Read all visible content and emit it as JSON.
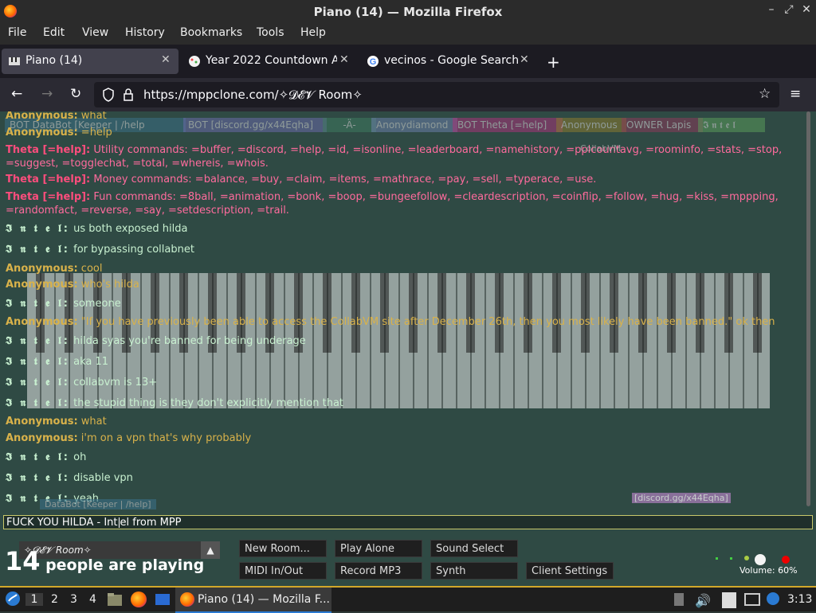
{
  "window": {
    "title": "Piano (14) — Mozilla Firefox",
    "controls": [
      "–",
      "⤢",
      "✕"
    ]
  },
  "menu": [
    "File",
    "Edit",
    "View",
    "History",
    "Bookmarks",
    "Tools",
    "Help"
  ],
  "tabs": [
    {
      "label": "Piano (14)",
      "active": true
    },
    {
      "label": "Year 2022 Countdown Ar",
      "active": false
    },
    {
      "label": "vecinos - Google Search",
      "active": false
    }
  ],
  "nav": {
    "url": "https://mppclone.com/✧𝓓𝓔𝓥 Room✧"
  },
  "usertags": [
    {
      "label": "BOT  DataBot [Keeper | /help",
      "color": "#3a6f87"
    },
    {
      "label": "BOT  [discord.gg/x44Eqha]",
      "color": "#6a6aa8"
    },
    {
      "label": "-Ä-",
      "color": "#3f7a60"
    },
    {
      "label": "Anonydiamond",
      "color": "#6a7ea8"
    },
    {
      "label": "BOT  Theta [=help]",
      "color": "#a8347a"
    },
    {
      "label": "Anonymous",
      "color": "#8a7a30"
    },
    {
      "label": "OWNER  Lapis",
      "color": "#8a3a5a"
    },
    {
      "label": "𝕴 𝖓 𝖙 𝖊 𝖑",
      "color": "#5a9a5a"
    }
  ],
  "chat": [
    {
      "type": "anon",
      "name": "Anonymous:",
      "text": "what"
    },
    {
      "type": "anon",
      "name": "Anonymous:",
      "text": "=help"
    },
    {
      "type": "theta",
      "name": "Theta [=help]:",
      "text": "Utility commands: =buffer, =discord, =help, =id, =isonline, =leaderboard, =namehistory, =pplcountavg, =roominfo, =stats, =stop, =suggest, =togglechat, =total, =whereis, =whois."
    },
    {
      "type": "theta",
      "name": "Theta [=help]:",
      "text": "Money commands: =balance, =buy, =claim, =items, =mathrace, =pay, =sell, =typerace, =use."
    },
    {
      "type": "theta",
      "name": "Theta [=help]:",
      "text": "Fun commands: =8ball, =animation, =bonk, =boop, =bungeefollow, =cleardescription, =coinflip, =follow, =hug, =kiss, =mppping, =randomfact, =reverse, =say, =setdescription, =trail."
    },
    {
      "type": "intel",
      "name": "𝕴 𝖓 𝖙 𝖊 𝖑:",
      "text": "us both exposed hilda"
    },
    {
      "type": "intel",
      "name": "𝕴 𝖓 𝖙 𝖊 𝖑:",
      "text": "for bypassing collabnet"
    },
    {
      "type": "anon",
      "name": "Anonymous:",
      "text": "cool"
    },
    {
      "type": "anon",
      "name": "Anonymous:",
      "text": "who's hilda"
    },
    {
      "type": "intel",
      "name": "𝕴 𝖓 𝖙 𝖊 𝖑:",
      "text": "someone"
    },
    {
      "type": "anon",
      "name": "Anonymous:",
      "text": "\"If you have previously been able to access the CollabVM site after December 26th, then you most likely have been banned.\" ok then"
    },
    {
      "type": "intel",
      "name": "𝕴 𝖓 𝖙 𝖊 𝖑:",
      "text": "hilda syas you're banned for being underage"
    },
    {
      "type": "intel",
      "name": "𝕴 𝖓 𝖙 𝖊 𝖑:",
      "text": "aka 11"
    },
    {
      "type": "intel",
      "name": "𝕴 𝖓 𝖙 𝖊 𝖑:",
      "text": "collabvm is 13+"
    },
    {
      "type": "intel",
      "name": "𝕴 𝖓 𝖙 𝖊 𝖑:",
      "text": "the stupid thing is they don't explicitly mention that"
    },
    {
      "type": "anon",
      "name": "Anonymous:",
      "text": "what"
    },
    {
      "type": "anon",
      "name": "Anonymous:",
      "text": "i'm on a vpn that's why probably"
    },
    {
      "type": "intel",
      "name": "𝕴 𝖓 𝖙 𝖊 𝖑:",
      "text": "oh"
    },
    {
      "type": "intel",
      "name": "𝕴 𝖓 𝖙 𝖊 𝖑:",
      "text": "disable vpn"
    },
    {
      "type": "intel",
      "name": "𝕴 𝖓 𝖙 𝖊 𝖑:",
      "text": "yeah"
    }
  ],
  "chat_input": {
    "value_before_cursor": "FUCK YOU HILDA - Int",
    "value_after_cursor": "el from MPP"
  },
  "cursor_labels": {
    "discord": "[discord.gg/x44Eqha]",
    "databot": "DataBot [Keeper | /help]",
    "collabvm": "CollabVM"
  },
  "controls": {
    "room": "✧𝓓𝓔𝓥 Room✧",
    "player_count": "14",
    "player_text": "people are playing",
    "buttons": [
      "New Room...",
      "Play Alone",
      "Sound Select",
      "MIDI In/Out",
      "Record MP3",
      "Synth",
      "Client Settings"
    ],
    "volume_label": "Volume: 60%",
    "volume_level": 0.6
  },
  "taskbar": {
    "workspaces": [
      "1",
      "2",
      "3",
      "4"
    ],
    "active_window": "Piano (14) — Mozilla F...",
    "clock": "3:13"
  }
}
